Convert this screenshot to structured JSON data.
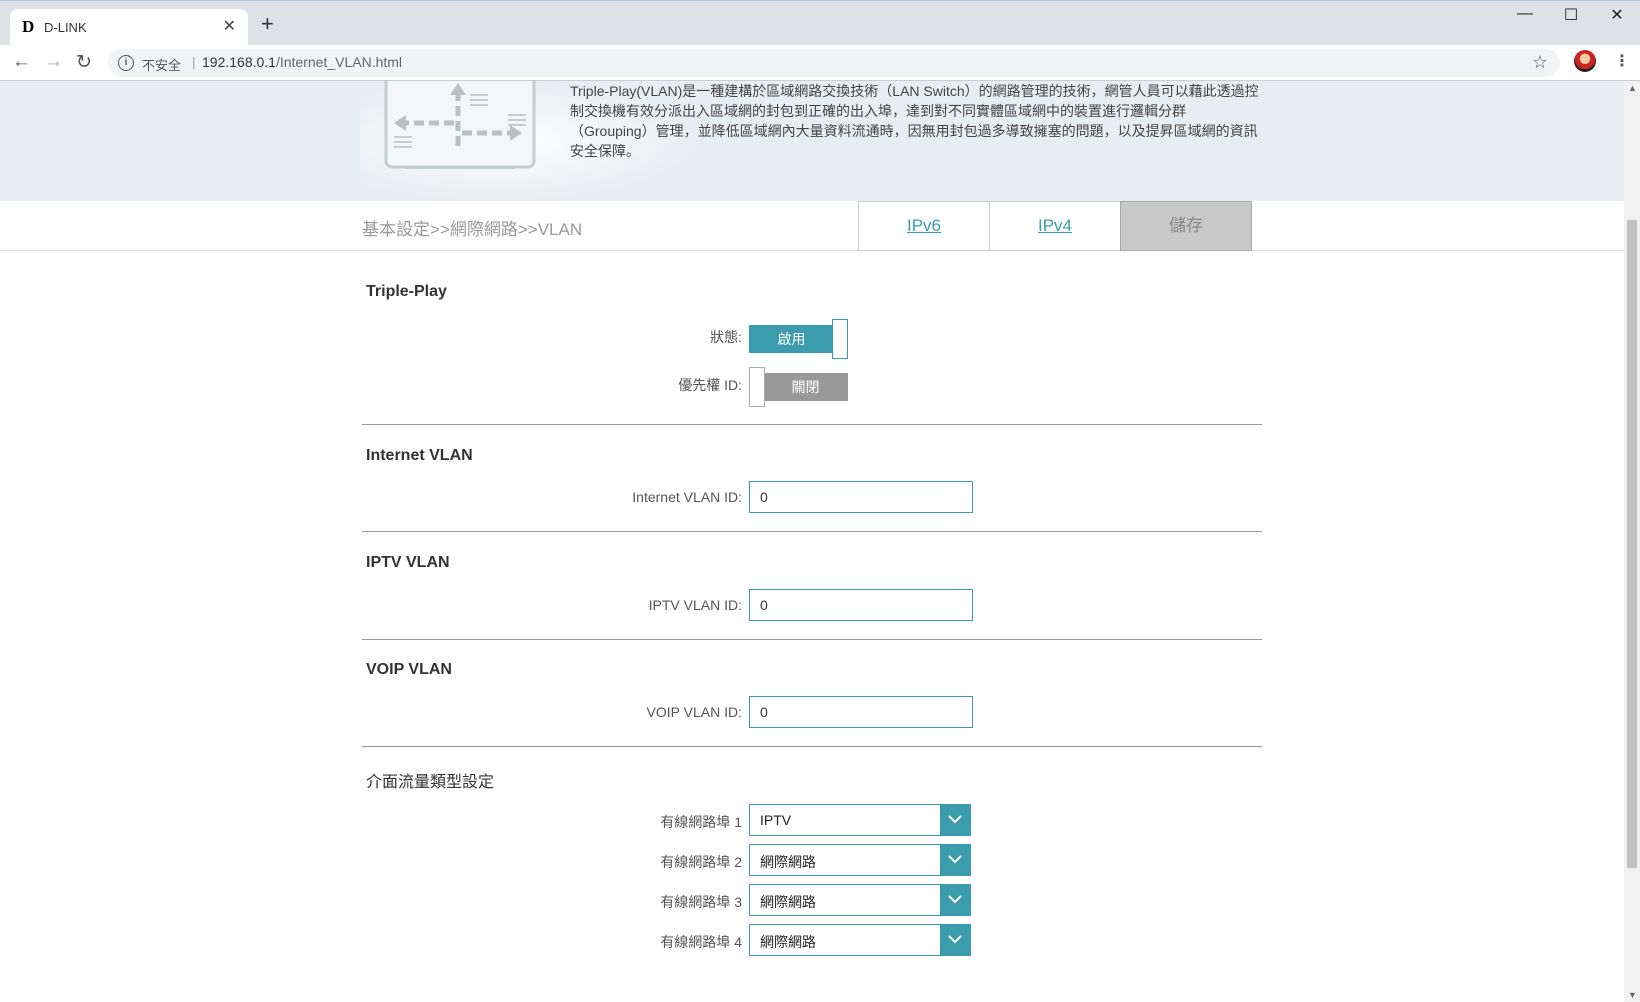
{
  "browser": {
    "tab_title": "D-LINK",
    "tab_logo": "D",
    "insecure_label": "不安全",
    "url_host": "192.168.0.1",
    "url_path": "/Internet_VLAN.html"
  },
  "banner": {
    "description": "Triple-Play(VLAN)是一種建構於區域網路交換技術（LAN Switch）的網路管理的技術，網管人員可以藉此透過控制交換機有效分派出入區域網的封包到正確的出入埠，達到對不同實體區域網中的裝置進行邏輯分群（Grouping）管理，並降低區域網內大量資料流通時，因無用封包過多導致擁塞的問題，以及提昇區域網的資訊安全保障。"
  },
  "subnav": {
    "breadcrumb": "基本設定>>網際網路>>VLAN",
    "tab_ipv6": "IPv6",
    "tab_ipv4": "IPv4",
    "save_label": "儲存"
  },
  "triple_play": {
    "title": "Triple-Play",
    "status_label": "狀態:",
    "status_value": "啟用",
    "priority_label": "優先權 ID:",
    "priority_value": "關閉"
  },
  "internet_vlan": {
    "title": "Internet VLAN",
    "label": "Internet VLAN ID:",
    "value": "0"
  },
  "iptv_vlan": {
    "title": "IPTV VLAN",
    "label": "IPTV VLAN ID:",
    "value": "0"
  },
  "voip_vlan": {
    "title": "VOIP VLAN",
    "label": "VOIP VLAN ID:",
    "value": "0"
  },
  "interface": {
    "title": "介面流量類型設定",
    "ports": [
      {
        "label": "有線網路埠 1",
        "value": "IPTV"
      },
      {
        "label": "有線網路埠 2",
        "value": "網際網路"
      },
      {
        "label": "有線網路埠 3",
        "value": "網際網路"
      },
      {
        "label": "有線網路埠 4",
        "value": "網際網路"
      }
    ]
  },
  "colors": {
    "accent": "#3a9cad",
    "toggle_off": "#999999",
    "banner_bg": "#e7eef1"
  }
}
